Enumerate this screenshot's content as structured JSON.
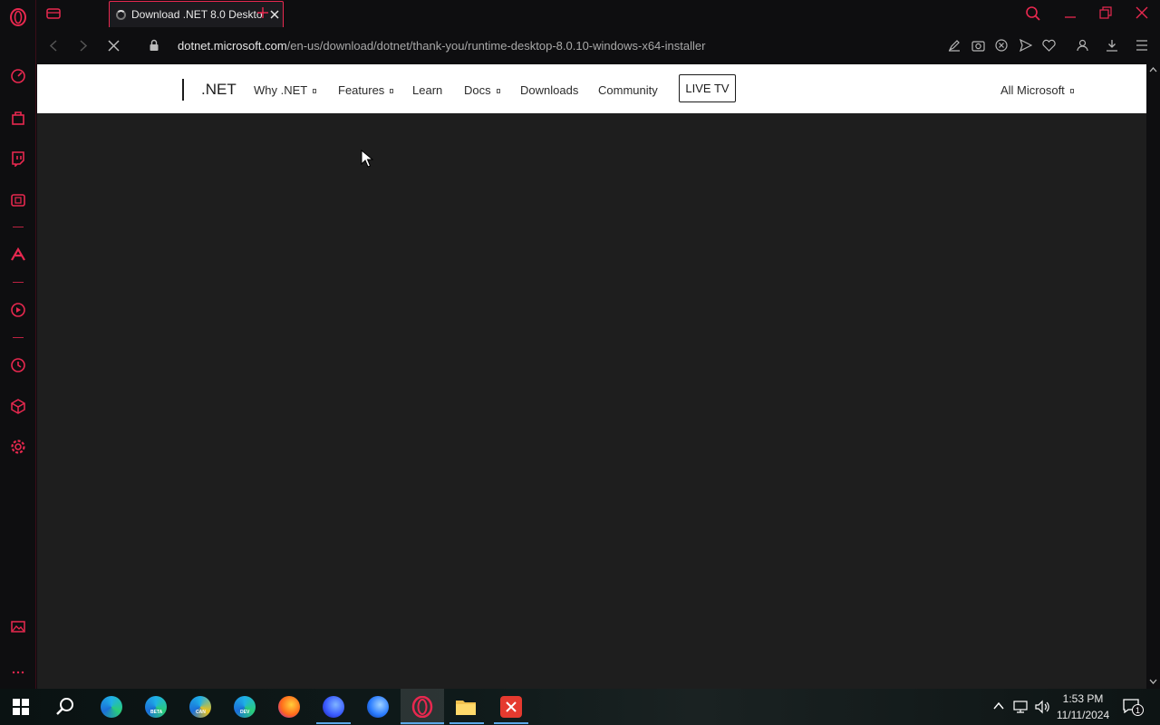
{
  "browser": {
    "tab_title": "Download .NET 8.0 Deskto",
    "url_host": "dotnet.microsoft.com",
    "url_path": "/en-us/download/dotnet/thank-you/runtime-desktop-8.0.10-windows-x64-installer",
    "accent_color": "#e8284f",
    "sidebar_icons": [
      "opera-logo-icon",
      "speed-dial-icon",
      "shop-icon",
      "twitch-icon",
      "gx-corner-icon",
      "aria-icon",
      "player-icon",
      "history-icon",
      "extensions-icon",
      "settings-icon",
      "snapshot-gallery-icon",
      "more-icon"
    ]
  },
  "site": {
    "brand": ".NET",
    "nav": {
      "why": "Why .NET",
      "features": "Features",
      "learn": "Learn",
      "docs": "Docs",
      "downloads": "Downloads",
      "community": "Community",
      "livetv": "LIVE TV",
      "all_microsoft": "All Microsoft"
    }
  },
  "taskbar": {
    "apps": [
      "start-icon",
      "search-icon",
      "edge-icon",
      "edge-beta-icon",
      "edge-canary-icon",
      "edge-dev-icon",
      "firefox-icon",
      "firefox-dev-icon",
      "firefox-nightly-icon",
      "opera-gx-icon",
      "file-explorer-icon",
      "red-x-app-icon"
    ],
    "badges": {
      "beta": "BETA",
      "can": "CAN",
      "dev": "DEV"
    },
    "time": "1:53 PM",
    "date": "11/11/2024",
    "notifications": "1"
  }
}
